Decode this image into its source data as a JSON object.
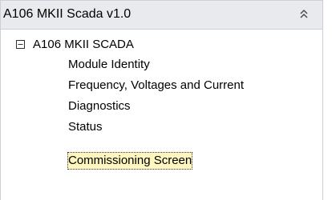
{
  "panel": {
    "title": "A106 MKII Scada v1.0",
    "collapse_icon": "double-chevron-up-icon"
  },
  "tree": {
    "root": {
      "label": "A106 MKII SCADA",
      "expanded": true,
      "expander_icon": "minus-box-icon"
    },
    "items": [
      {
        "label": "Module Identity"
      },
      {
        "label": "Frequency, Voltages and Current"
      },
      {
        "label": "Diagnostics"
      },
      {
        "label": "Status"
      },
      {
        "label": "Commissioning Screen",
        "selected": true
      }
    ]
  },
  "colors": {
    "header_bg": "#e9eaee",
    "border": "#c9d0da",
    "selection_bg": "#fff5bf"
  }
}
